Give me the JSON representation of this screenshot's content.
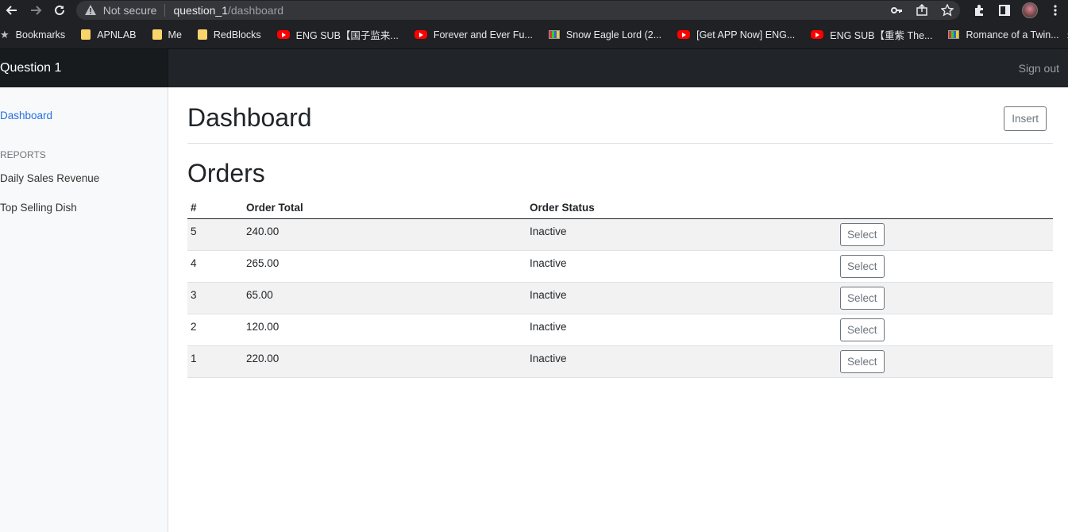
{
  "browser": {
    "security_label": "Not secure",
    "url_host": "question_1",
    "url_path": "/dashboard"
  },
  "bookmarks": [
    {
      "label": "Bookmarks",
      "icon": "star-icon"
    },
    {
      "label": "APNLAB",
      "icon": "folder-icon"
    },
    {
      "label": "Me",
      "icon": "folder-icon"
    },
    {
      "label": "RedBlocks",
      "icon": "folder-icon"
    },
    {
      "label": "ENG SUB【国子监来...",
      "icon": "youtube-icon"
    },
    {
      "label": "Forever and Ever Fu...",
      "icon": "youtube-icon"
    },
    {
      "label": "Snow Eagle Lord (2...",
      "icon": "tv-icon"
    },
    {
      "label": "[Get APP Now] ENG...",
      "icon": "youtube-icon"
    },
    {
      "label": "ENG SUB【重紫 The...",
      "icon": "youtube-icon"
    },
    {
      "label": "Romance of a Twin...",
      "icon": "tv-icon"
    }
  ],
  "bookmarks_more": "»",
  "app": {
    "brand": "Question 1",
    "sign_out": "Sign out"
  },
  "sidebar": {
    "dashboard": "Dashboard",
    "reports_heading": "REPORTS",
    "daily_sales": "Daily Sales Revenue",
    "top_selling": "Top Selling Dish"
  },
  "main": {
    "title": "Dashboard",
    "insert_label": "Insert",
    "section_title": "Orders",
    "columns": [
      "#",
      "Order Total",
      "Order Status",
      ""
    ],
    "select_label": "Select",
    "rows": [
      {
        "id": "5",
        "total": "240.00",
        "status": "Inactive"
      },
      {
        "id": "4",
        "total": "265.00",
        "status": "Inactive"
      },
      {
        "id": "3",
        "total": "65.00",
        "status": "Inactive"
      },
      {
        "id": "2",
        "total": "120.00",
        "status": "Inactive"
      },
      {
        "id": "1",
        "total": "220.00",
        "status": "Inactive"
      }
    ]
  }
}
